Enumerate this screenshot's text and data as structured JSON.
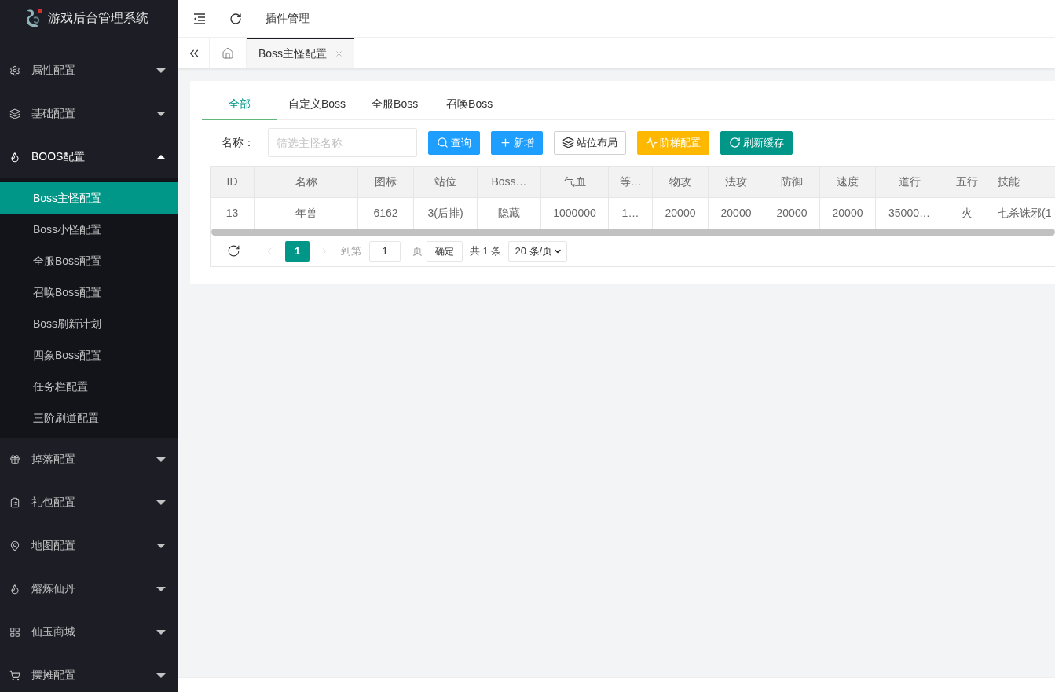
{
  "sidebar": {
    "title": "游戏后台管理系统",
    "items": [
      {
        "label": "属性配置",
        "expanded": false
      },
      {
        "label": "基础配置",
        "expanded": false
      },
      {
        "label": "BOOS配置",
        "expanded": true,
        "children": [
          {
            "label": "Boss主怪配置",
            "selected": true
          },
          {
            "label": "Boss小怪配置",
            "selected": false
          },
          {
            "label": "全服Boss配置",
            "selected": false
          },
          {
            "label": "召唤Boss配置",
            "selected": false
          },
          {
            "label": "Boss刷新计划",
            "selected": false
          },
          {
            "label": "四象Boss配置",
            "selected": false
          },
          {
            "label": "任务栏配置",
            "selected": false
          },
          {
            "label": "三阶刷道配置",
            "selected": false
          }
        ]
      },
      {
        "label": "掉落配置",
        "expanded": false
      },
      {
        "label": "礼包配置",
        "expanded": false
      },
      {
        "label": "地图配置",
        "expanded": false
      },
      {
        "label": "熔炼仙丹",
        "expanded": false
      },
      {
        "label": "仙玉商城",
        "expanded": false
      },
      {
        "label": "摆摊配置",
        "expanded": false
      }
    ]
  },
  "header": {
    "link": "插件管理"
  },
  "page_tabs": [
    {
      "label": "Boss主怪配置",
      "selected": true
    }
  ],
  "card": {
    "tabs": [
      {
        "label": "全部",
        "selected": true
      },
      {
        "label": "自定义Boss",
        "selected": false
      },
      {
        "label": "全服Boss",
        "selected": false
      },
      {
        "label": "召唤Boss",
        "selected": false
      }
    ],
    "filter": {
      "label": "名称：",
      "placeholder": "筛选主怪名称"
    },
    "buttons": [
      {
        "label": "查询",
        "kind": "info"
      },
      {
        "label": "新增",
        "kind": "info"
      },
      {
        "label": "站位布局",
        "kind": "plain"
      },
      {
        "label": "阶梯配置",
        "kind": "warm"
      },
      {
        "label": "刷新缓存",
        "kind": "primary"
      }
    ]
  },
  "table": {
    "columns": [
      "ID",
      "名称",
      "图标",
      "站位",
      "Boss…",
      "气血",
      "等…",
      "物攻",
      "法攻",
      "防御",
      "速度",
      "道行",
      "五行",
      "技能"
    ],
    "rows": [
      [
        "13",
        "年兽",
        "6162",
        "3(后排)",
        "隐藏",
        "1000000",
        "1…",
        "20000",
        "20000",
        "20000",
        "20000",
        "35000…",
        "火",
        "七杀诛邪(1"
      ]
    ]
  },
  "pagination": {
    "prev": {
      "disabled": true
    },
    "pages": [
      {
        "label": "1",
        "selected": true
      }
    ],
    "next": {
      "disabled": true
    },
    "goto_label": "到第",
    "goto_value": "1",
    "page_suffix": "页",
    "confirm": "确定",
    "total": "共 1 条",
    "page_size": "20 条/页"
  }
}
